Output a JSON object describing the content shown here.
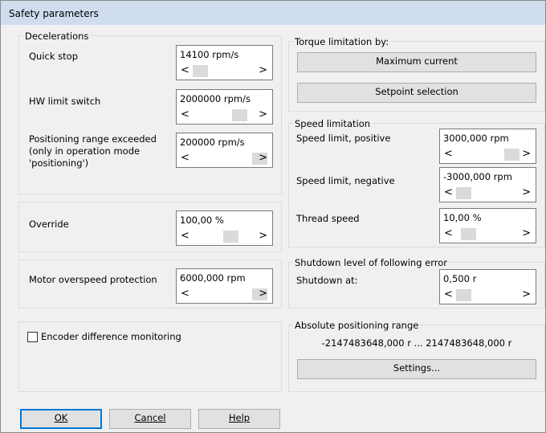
{
  "window": {
    "title": "Safety parameters"
  },
  "decelerations": {
    "header": "Decelerations",
    "quick_stop": {
      "label": "Quick stop",
      "value": "14100 rpm/s"
    },
    "hw_limit_switch": {
      "label": "HW limit switch",
      "value": "2000000 rpm/s"
    },
    "positioning_range": {
      "label_lines": [
        "Positioning range exceeded",
        "(only in operation mode",
        "'positioning')"
      ],
      "value": "200000 rpm/s"
    }
  },
  "override": {
    "label": "Override",
    "value": "100,00 %"
  },
  "motor_overspeed": {
    "label": "Motor overspeed protection",
    "value": "6000,000 rpm"
  },
  "encoder": {
    "label": "Encoder difference monitoring",
    "checked": false
  },
  "torque": {
    "header": "Torque limitation by:",
    "max_current_label": "Maximum current",
    "setpoint_label": "Setpoint selection"
  },
  "speed_limitation": {
    "header": "Speed limitation",
    "positive": {
      "label": "Speed limit, positive",
      "value": "3000,000 rpm"
    },
    "negative": {
      "label": "Speed limit, negative",
      "value": "-3000,000 rpm"
    },
    "thread": {
      "label": "Thread speed",
      "value": "10,00 %"
    }
  },
  "shutdown": {
    "header": "Shutdown level of following error",
    "label": "Shutdown at:",
    "value": "0,500 r"
  },
  "absolute": {
    "header": "Absolute positioning range",
    "range": "-2147483648,000  r ... 2147483648,000  r",
    "settings_label": "Settings..."
  },
  "footer": {
    "ok": "OK",
    "cancel": "Cancel",
    "help": "Help"
  },
  "spinner_arrows": {
    "left": "<",
    "right": ">"
  },
  "scroll_positions": {
    "quick_stop": 0.02,
    "hw_limit_switch": 0.64,
    "positioning_range": 0.95,
    "override": 0.5,
    "motor_overspeed": 0.95,
    "speed_positive": 0.77,
    "speed_negative": 0.02,
    "thread": 0.1,
    "shutdown": 0.02
  },
  "colors": {
    "titlebar": "#cfddef",
    "dialog": "#f0f0f0",
    "button": "#e1e1e1",
    "default_border": "#0078d7"
  }
}
